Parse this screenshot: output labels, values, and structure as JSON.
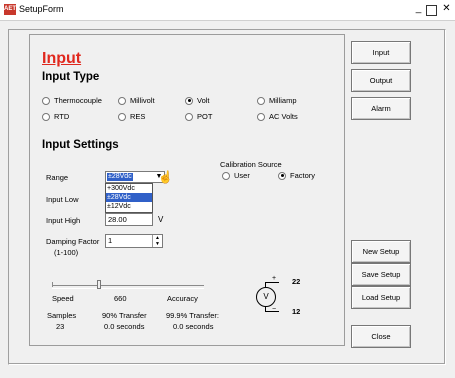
{
  "window": {
    "app_icon_text": "AET",
    "title": "SetupForm",
    "minimize": "_",
    "maximize": "□",
    "close": "✕"
  },
  "heading": "Input",
  "input_type": {
    "title": "Input Type",
    "options": [
      {
        "label": "Thermocouple",
        "selected": false
      },
      {
        "label": "Millivolt",
        "selected": false
      },
      {
        "label": "Volt",
        "selected": true
      },
      {
        "label": "Milliamp",
        "selected": false
      },
      {
        "label": "RTD",
        "selected": false
      },
      {
        "label": "RES",
        "selected": false
      },
      {
        "label": "POT",
        "selected": false
      },
      {
        "label": "AC Volts",
        "selected": false
      }
    ]
  },
  "input_settings": {
    "title": "Input Settings",
    "range_label": "Range",
    "range_value": "±28Vdc",
    "range_options": [
      "+300Vdc",
      "±28Vdc",
      "±12Vdc"
    ],
    "range_highlighted": "±28Vdc",
    "input_low_label": "Input Low",
    "input_high_label": "Input High",
    "input_high_value": "28.00",
    "input_high_unit": "V",
    "damping_label": "Damping Factor",
    "damping_range": "(1-100)",
    "damping_value": "1",
    "calibration_title": "Calibration Source",
    "calibration_options": [
      {
        "label": "User",
        "selected": false
      },
      {
        "label": "Factory",
        "selected": true
      }
    ]
  },
  "speed": {
    "speed_label": "Speed",
    "speed_value": "660",
    "accuracy_label": "Accuracy",
    "samples_label": "Samples",
    "samples_value": "23",
    "transfer90_label": "90% Transfer",
    "transfer90_value": "0.0 seconds",
    "transfer999_label": "99.9% Transfer:",
    "transfer999_value": "0.0 seconds"
  },
  "diagram": {
    "meter_symbol": "V",
    "terminal_top": "22",
    "terminal_bottom": "12",
    "plus": "+",
    "minus": "−"
  },
  "sidebar": {
    "input": "Input",
    "output": "Output",
    "alarm": "Alarm",
    "new_setup": "New Setup",
    "save_setup": "Save Setup",
    "load_setup": "Load Setup",
    "close": "Close"
  }
}
